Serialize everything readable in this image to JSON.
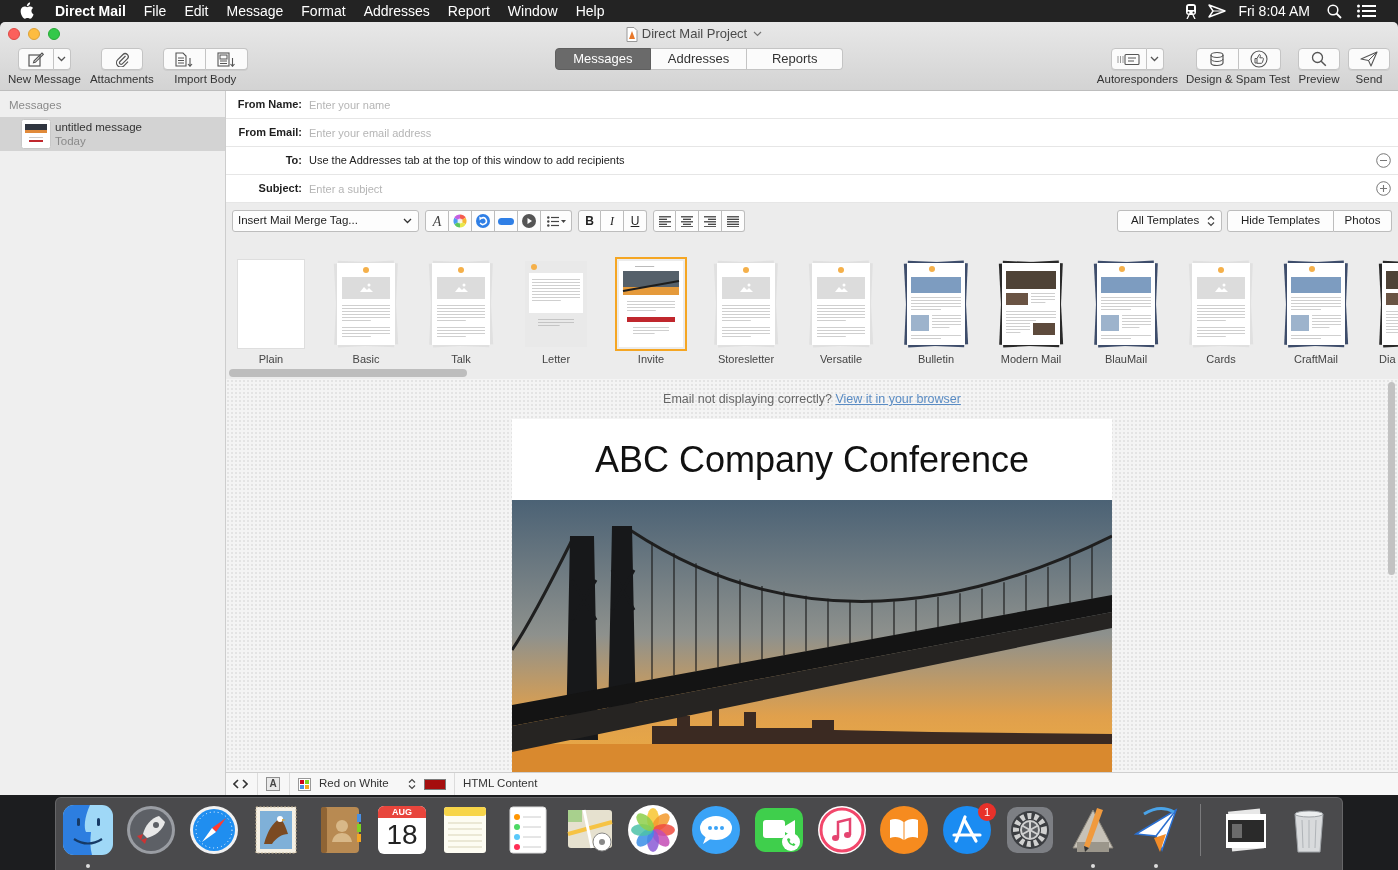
{
  "menu_bar": {
    "app_name": "Direct Mail",
    "menus": [
      "File",
      "Edit",
      "Message",
      "Format",
      "Addresses",
      "Report",
      "Window",
      "Help"
    ],
    "clock": "Fri 8:04 AM"
  },
  "window": {
    "title": "Direct Mail Project"
  },
  "toolbar": {
    "left": [
      {
        "label": "New Message",
        "kind": "split"
      },
      {
        "label": "Attachments",
        "kind": "single"
      },
      {
        "label": "Import Body",
        "kind": "pair"
      }
    ],
    "tabs": [
      {
        "label": "Messages",
        "selected": true
      },
      {
        "label": "Addresses",
        "selected": false
      },
      {
        "label": "Reports",
        "selected": false
      }
    ],
    "right": [
      {
        "label": "Autoresponders",
        "kind": "split"
      },
      {
        "label": "Design & Spam Test",
        "kind": "pair"
      },
      {
        "label": "Preview",
        "kind": "single"
      },
      {
        "label": "Send",
        "kind": "single"
      }
    ]
  },
  "sidebar": {
    "header": "Messages",
    "items": [
      {
        "title": "untitled message",
        "date": "Today",
        "selected": true
      }
    ]
  },
  "header_fields": [
    {
      "label": "From Name:",
      "placeholder": "Enter your name"
    },
    {
      "label": "From Email:",
      "placeholder": "Enter your email address"
    },
    {
      "label": "To:",
      "note": "Use the Addresses tab at the top of this window to add recipients"
    },
    {
      "label": "Subject:",
      "placeholder": "Enter a subject"
    }
  ],
  "format_bar": {
    "merge_tag_menu": "Insert Mail Merge Tag...",
    "font_button": "A",
    "style_buttons": [
      "B",
      "I",
      "U"
    ],
    "template_filter": "All Templates",
    "buttons": [
      "Hide Templates",
      "Photos"
    ]
  },
  "templates": [
    {
      "name": "Plain",
      "kind": "blank",
      "selected": false
    },
    {
      "name": "Basic",
      "kind": "light",
      "selected": false
    },
    {
      "name": "Talk",
      "kind": "light",
      "selected": false
    },
    {
      "name": "Letter",
      "kind": "letter",
      "selected": false
    },
    {
      "name": "Invite",
      "kind": "photo",
      "selected": true
    },
    {
      "name": "Storesletter",
      "kind": "light",
      "selected": false
    },
    {
      "name": "Versatile",
      "kind": "light",
      "selected": false
    },
    {
      "name": "Bulletin",
      "kind": "navy",
      "selected": false
    },
    {
      "name": "Modern Mail",
      "kind": "dark",
      "selected": false
    },
    {
      "name": "BlauMail",
      "kind": "navy",
      "selected": false
    },
    {
      "name": "Cards",
      "kind": "light",
      "selected": false
    },
    {
      "name": "CraftMail",
      "kind": "navy",
      "selected": false
    },
    {
      "name": "Dia",
      "kind": "dark",
      "selected": false
    }
  ],
  "preview": {
    "notice": "Email not displaying correctly?",
    "link": "View it in your browser",
    "email": {
      "heading": "ABC Company Conference"
    }
  },
  "status_bar": {
    "font_badge": "A",
    "color_scheme": "Red on White",
    "content_type": "HTML Content"
  },
  "dock": {
    "apps": [
      {
        "running": true
      },
      {
        "running": false
      },
      {
        "running": false
      },
      {
        "running": false
      },
      {
        "running": false
      },
      {
        "running": false,
        "month": "AUG",
        "day": "18"
      },
      {
        "running": false
      },
      {
        "running": false
      },
      {
        "running": false
      },
      {
        "running": false
      },
      {
        "running": false
      },
      {
        "running": false
      },
      {
        "running": false
      },
      {
        "running": false
      },
      {
        "running": false,
        "badge": "1"
      },
      {
        "running": false
      },
      {
        "running": true
      },
      {
        "running": true
      }
    ],
    "others": [
      {
        "running": false
      },
      {
        "running": false
      }
    ]
  }
}
